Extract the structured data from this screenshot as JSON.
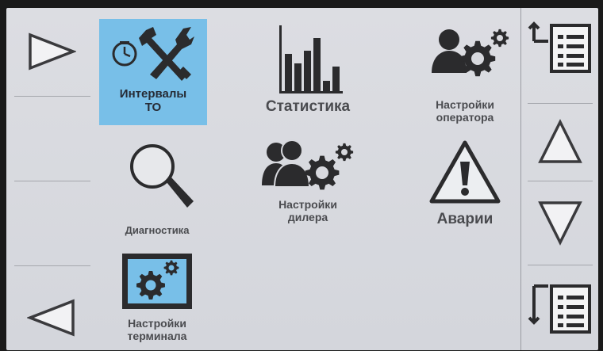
{
  "nav_left": {
    "forward_icon": "triangle-right-icon",
    "back_icon": "triangle-left-icon"
  },
  "nav_right": {
    "list_top_icon": "list-jump-top-icon",
    "up_icon": "triangle-up-icon",
    "down_icon": "triangle-down-icon",
    "list_bottom_icon": "list-jump-bottom-icon"
  },
  "menu": {
    "intervals": {
      "line1": "Интервалы",
      "line2": "ТО",
      "icon": "clock-tools-icon",
      "selected": true
    },
    "statistics": {
      "label": "Статистика",
      "icon": "bar-chart-icon"
    },
    "operator_settings": {
      "line1": "Настройки",
      "line2": "оператора",
      "icon": "user-gear-icon"
    },
    "diagnostics": {
      "label": "Диагностика",
      "icon": "magnifier-icon"
    },
    "dealer_settings": {
      "line1": "Настройки",
      "line2": "дилера",
      "icon": "users-gear-icon"
    },
    "alarms": {
      "label": "Аварии",
      "icon": "warning-icon"
    },
    "terminal_settings": {
      "line1": "Настройки",
      "line2": "терминала",
      "icon": "monitor-gear-icon"
    }
  },
  "colors": {
    "background": "#d8d9de",
    "selected": "#78bfe8",
    "icon": "#2b2b2d",
    "label": "#4a4b4f"
  }
}
